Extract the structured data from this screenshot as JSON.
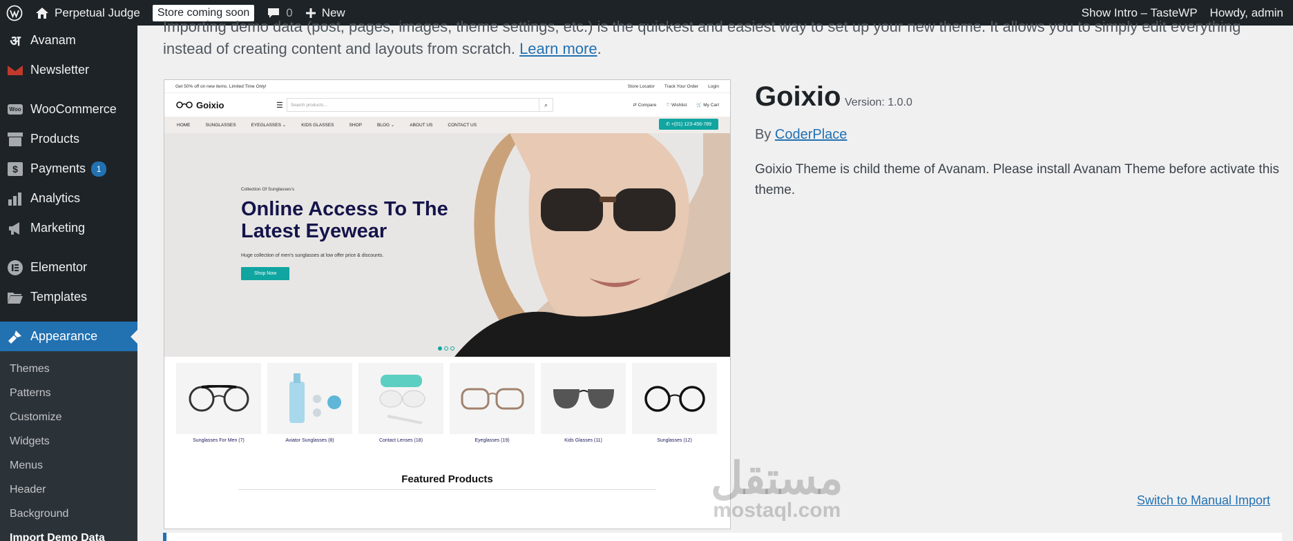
{
  "adminbar": {
    "site_name": "Perpetual Judge",
    "store_badge": "Store coming soon",
    "comments_count": "0",
    "new_label": "New",
    "show_intro": "Show Intro – TasteWP",
    "howdy": "Howdy, admin"
  },
  "sidebar": {
    "items": [
      {
        "label": "Avanam",
        "icon": "avanam-icon"
      },
      {
        "label": "Newsletter",
        "icon": "mail-icon"
      },
      {
        "label": "WooCommerce",
        "icon": "woo-icon"
      },
      {
        "label": "Products",
        "icon": "archive-icon"
      },
      {
        "label": "Payments",
        "icon": "dollar-icon",
        "badge": "1"
      },
      {
        "label": "Analytics",
        "icon": "chart-bar-icon"
      },
      {
        "label": "Marketing",
        "icon": "megaphone-icon"
      },
      {
        "label": "Elementor",
        "icon": "elementor-icon"
      },
      {
        "label": "Templates",
        "icon": "folder-icon"
      },
      {
        "label": "Appearance",
        "icon": "brush-icon"
      }
    ],
    "submenu": [
      "Themes",
      "Patterns",
      "Customize",
      "Widgets",
      "Menus",
      "Header",
      "Background",
      "Import Demo Data"
    ]
  },
  "intro": {
    "text": "Importing demo data (post, pages, images, theme settings, etc.) is the quickest and easiest way to set up your new theme. It allows you to simply edit everything instead of creating content and layouts from scratch. ",
    "link": "Learn more",
    "end": "."
  },
  "preview": {
    "topbar_left": "Get 50% off on new items. Limited Time Only!",
    "topbar_right": [
      "Store Locator",
      "Track Your Order",
      "Login"
    ],
    "logo": "Goixio",
    "search_placeholder": "Search products...",
    "actions": [
      "Compare",
      "Wishlist",
      "My Cart"
    ],
    "nav": [
      "HOME",
      "SUNGLASSES",
      "EYEGLASSES ⌄",
      "KIDS GLASSES",
      "SHOP",
      "BLOG ⌄",
      "ABOUT US",
      "CONTACT US"
    ],
    "phone": "+(01) 123-456-789",
    "hero_small": "Collection Of Sunglasses's",
    "hero_title": "Online Access To The Latest Eyewear",
    "hero_desc": "Huge collection of men's sunglasses at low offer price & discounts.",
    "hero_btn": "Shop Now",
    "categories": [
      "Sunglasses For Men (7)",
      "Aviator Sunglasses (8)",
      "Contact Lenses (18)",
      "Eyeglasses (19)",
      "Kids Glasses (11)",
      "Sunglasses (12)"
    ],
    "featured": "Featured Products"
  },
  "theme": {
    "name": "Goixio",
    "version": "Version: 1.0.0",
    "by": "By ",
    "author": "CoderPlace",
    "description": "Goixio Theme is child theme of Avanam. Please install Avanam Theme before activate this theme."
  },
  "switch_link": "Switch to Manual Import",
  "watermark": {
    "arabic": "مستقل",
    "latin": "mostaql.com"
  },
  "colors": {
    "adminbar": "#1d2327",
    "accent": "#2271b1",
    "teal": "#10a5a0"
  }
}
